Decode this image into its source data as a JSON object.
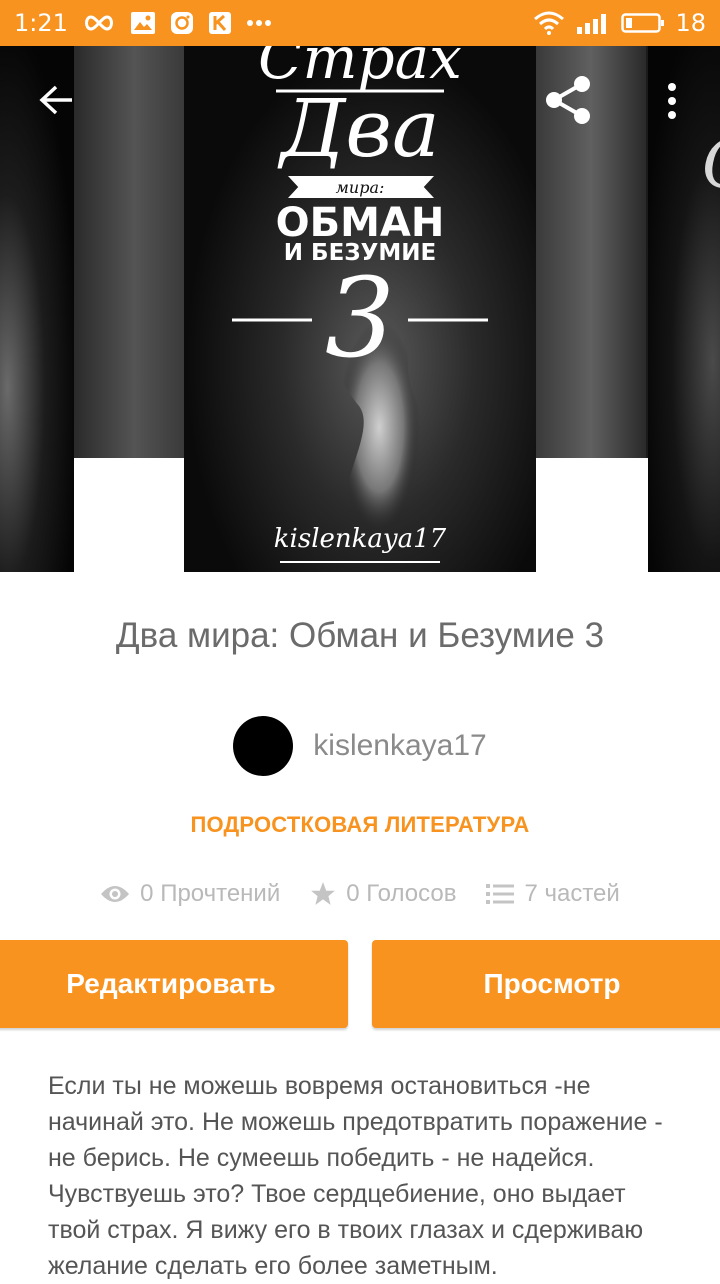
{
  "status_bar": {
    "time": "1:21",
    "battery_level": "18",
    "color": "#f7931e"
  },
  "cover": {
    "line1": "Страх",
    "line2": "Два",
    "line3": "мира:",
    "line4": "ОБМАН",
    "line5": "И БЕЗУМИЕ",
    "number": "3",
    "author": "kislenkaya17",
    "side_right_text": "С"
  },
  "book": {
    "title": "Два мира: Обман и Безумие 3",
    "author": "kislenkaya17",
    "category": "ПОДРОСТКОВАЯ ЛИТЕРАТУРА"
  },
  "stats": {
    "reads": "0 Прочтений",
    "votes": "0 Голосов",
    "parts": "7 частей"
  },
  "actions": {
    "edit_label": "Редактировать",
    "preview_label": "Просмотр"
  },
  "description": "Если ты не можешь вовремя остановиться -не начинай это. Не можешь предотвратить поражение - не берись. Не сумеешь победить - не надейся. Чувствуешь это? Твое сердцебиение, оно выдает твой страх. Я вижу его в твоих глазах и сдерживаю желание сделать его более заметным.",
  "icons": [
    "infinity-icon",
    "image-icon",
    "instagram-icon",
    "k-app-icon",
    "more-dots-icon",
    "wifi-icon",
    "signal-icon",
    "battery-icon",
    "back-arrow-icon",
    "share-icon",
    "overflow-menu-icon",
    "eye-icon",
    "star-icon",
    "list-icon"
  ]
}
